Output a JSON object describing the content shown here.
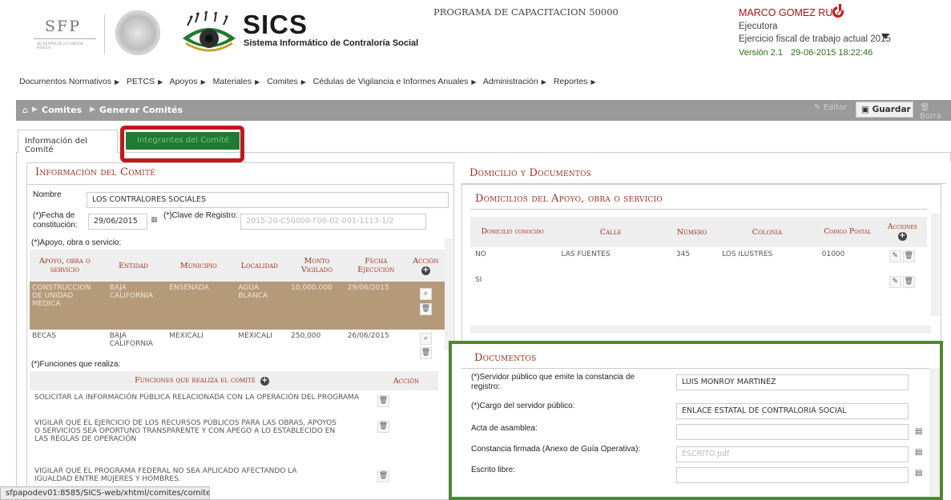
{
  "header": {
    "sfp_logo": "SFP",
    "sfp_logo_small": "SECRETARÍA DE LA FUNCIÓN PÚBLICA",
    "app_title": "SICS",
    "app_subtitle": "Sistema Informático de Contraloría Social",
    "program": "PROGRAMA DE CAPACITACION 50000",
    "user_name": "MARCO GOMEZ RUIZ",
    "user_role": "Ejecutora",
    "fiscal_year": "Ejercicio fiscal de trabajo actual 2015",
    "version": "Versión 2.1",
    "datetime": "29-06-2015 18:22:46",
    "colors": {
      "brand_red": "#b3120f",
      "version_green": "#2e6f12"
    }
  },
  "menu": [
    "Documentos Normativos",
    "PETCS",
    "Apoyos",
    "Materiales",
    "Comites",
    "Cédulas de Vigilancia e Informes Anuales",
    "Administración",
    "Reportes"
  ],
  "breadcrumb": {
    "items": [
      "Comites",
      "Generar Comités"
    ]
  },
  "toolbar": {
    "edit": "Editar",
    "save": "Guardar",
    "delete": "Borra"
  },
  "tabs": {
    "info": "Información del Comité",
    "members": "Integrantes del Comité"
  },
  "left": {
    "title": "Información del Comité",
    "nombre_label": "Nombre",
    "nombre_value": "LOS CONTRALORES SOCIALES",
    "fecha_label": "(*)Fecha de constitución:",
    "fecha_value": "29/06/2015",
    "clave_label": "(*)Clave de Registro:",
    "clave_value": "2015-20-C50000-F00-02-001-1113-1/2",
    "apoyo_label": "(*)Apoyo, obra o servicio:",
    "apoyo_headers": [
      "Apoyo, obra o servicio",
      "Entidad",
      "Municipio",
      "Localidad",
      "Monto Vigilado",
      "Fecha Ejecución",
      "Acción"
    ],
    "apoyo_rows": [
      [
        "CONSTRUCCION DE UNIDAD MEDICA",
        "BAJA CALIFORNIA",
        "ENSENADA",
        "AGUA BLANCA",
        "10,000.000",
        "29/06/2015"
      ],
      [
        "BECAS",
        "BAJA CALIFORNIA",
        "MEXICALI",
        "MEXICALI",
        "250,000",
        "26/06/2015"
      ]
    ],
    "funciones_label": "(*)Funciones que realiza:",
    "funciones_headers": [
      "Funciones que realiza el comité",
      "Acción"
    ],
    "funciones_rows": [
      "SOLICITAR LA INFORMACIÓN PÚBLICA RELACIONADA CON LA OPERACIÓN DEL PROGRAMA",
      "VIGILAR QUE EL EJERCICIO DE LOS RECURSOS PÚBLICOS PARA LAS OBRAS, APOYOS O SERVICIOS SEA OPORTUNO TRANSPARENTE Y CON APEGO A LO ESTABLECIDO EN LAS REGLAS DE OPERACIÓN",
      "VIGILAR QUE EL PROGRAMA FEDERAL NO SEA APLICADO AFECTANDO LA IGUALDAD ENTRE MUJERES Y HOMBRES."
    ]
  },
  "right": {
    "title": "Domicilio y Documentos",
    "dom_title": "Domicilios del Apoyo, obra o servicio",
    "dom_headers": [
      "Domicilio conocido",
      "Calle",
      "Número",
      "Colonia",
      "Codigo Postal",
      "Acciones"
    ],
    "dom_rows": [
      [
        "NO",
        "LAS FUENTES",
        "345",
        "LOS ILUSTRES",
        "01000"
      ],
      [
        "SI",
        "",
        "",
        "",
        ""
      ]
    ],
    "doc_title": "Documentos",
    "doc_rows": [
      {
        "label": "(*)Servidor público que emite la constancia de registro:",
        "value": ""
      },
      {
        "label": "(*)Cargo del servidor público:",
        "value": "ENLACE ESTATAL DE CONTRALORIA SOCIAL"
      },
      {
        "label": "Acta de asamblea:",
        "value": ""
      },
      {
        "label": "Constancia firmada (Anexo de Guía Operativa):",
        "value": "ESCRITO.pdf"
      },
      {
        "label": "Escrito libre:",
        "value": ""
      }
    ],
    "servidor_value": "LUIS MONROY MARTINEZ"
  },
  "status_bar": "sfpapodev01:8585/SICS-web/xhtml/comites/comites.jsf#fcontenido:tabComite:tab2"
}
